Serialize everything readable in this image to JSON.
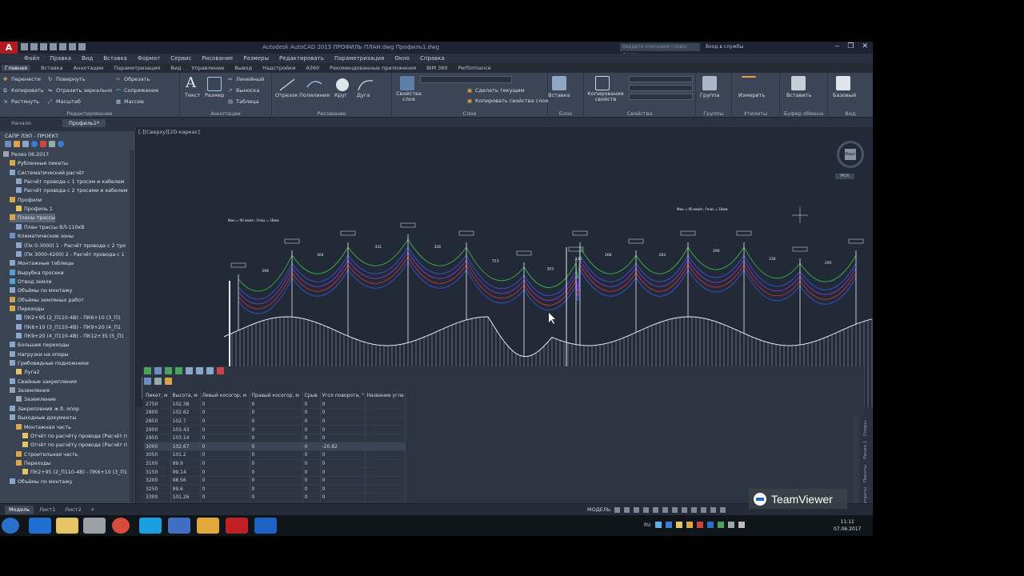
{
  "titlebar": {
    "logo": "A",
    "title": "Autodesk AutoCAD 2015   ПРОФИЛЬ ПЛАН.dwg   Профиль1.dwg",
    "search_placeholder": "Введите ключевое слово/фразу",
    "signin": "Вход в службы"
  },
  "menu": [
    "Файл",
    "Правка",
    "Вид",
    "Вставка",
    "Формат",
    "Сервис",
    "Рисование",
    "Размеры",
    "Редактировать",
    "Параметризация",
    "Окно",
    "Справка"
  ],
  "ribbon_tabs": [
    "Главная",
    "Вставка",
    "Аннотации",
    "Параметризация",
    "Вид",
    "Управление",
    "Вывод",
    "Надстройки",
    "A360",
    "Рекомендованные приложения",
    "BIM 360",
    "Performance"
  ],
  "ribbon": {
    "edit": {
      "title": "Редактирование",
      "buttons": [
        "Перенести",
        "Повернуть",
        "Обрезать",
        "Копировать",
        "Отразить зеркально",
        "Сопряжение",
        "Растянуть",
        "Масштаб",
        "Массив"
      ]
    },
    "annot": {
      "title": "Аннотации",
      "buttons": [
        "Текст",
        "Размер",
        "Линейный",
        "Выноска",
        "Таблица"
      ]
    },
    "draw": {
      "title": "Рисование",
      "buttons": [
        "Отрезок",
        "Полилиния",
        "Круг",
        "Дуга"
      ]
    },
    "layers": {
      "title": "Слои",
      "buttons": [
        "Свойства слоя",
        "Сделать текущим",
        "Копировать свойства слоя"
      ]
    },
    "block": {
      "title": "Блок",
      "button": "Вставка"
    },
    "props": {
      "title": "Свойства",
      "button": "Копирование свойств"
    },
    "groups": {
      "title": "Группы",
      "button": "Группа"
    },
    "util": {
      "title": "Утилиты",
      "button": "Измерить"
    },
    "clip": {
      "title": "Буфер обмена",
      "button": "Вставить"
    },
    "view": {
      "title": "Вид",
      "button": "Базовый"
    }
  },
  "doctabs": [
    "Начало",
    "Профиль1*"
  ],
  "leftpanel": {
    "title": "САПР ЛЭП - ПРОЕКТ",
    "tree": [
      "Релиз 06.2017",
      "Рубленные пикеты",
      "Систематический расчёт",
      "Расчёт провода с 1 тросом и кабелем",
      "Расчёт провода с 2 тросами и кабелем",
      "Профили",
      "Профиль 1",
      "Планы трассы",
      "План трассы ВЛ-110кВ",
      "Климатические зоны",
      "(Пк 0-3000) 1 - Расчёт провода с 2 тро",
      "(Пк 3000-4200) 2 - Расчёт провода с 1",
      "Монтажные таблицы",
      "Вырубка просеки",
      "Отвод земли",
      "Объёмы по монтажу",
      "Объёмы земляных работ",
      "Переходы",
      "ПК2+95 (2_П110-4В) - ПК6+10 (3_П1",
      "ПК6+10 (3_П110-4В) - ПК9+20 (4_П1",
      "ПК9+20 (4_П110-4В) - ПК12+35 (5_П1",
      "Большие переходы",
      "Нагрузки на опоры",
      "Грибовидные подножники",
      "Луга2",
      "Свайные закрепления",
      "Заземления",
      "Заземление",
      "Закрепления ж.б. опор",
      "Выходные документы",
      "Монтажная часть",
      "Отчёт по расчёту провода (Расчёт п",
      "Отчёт по расчёту провода (Расчёт п",
      "Строительная часть",
      "Переходы",
      "ПК2+95 (2_П110-4В) - ПК6+10 (3_П1",
      "Объёмы по монтажу"
    ]
  },
  "viewport": {
    "label": "[-][Сверху][2D-каркас]",
    "nav_label": "Верх",
    "nav_unit": "МСК",
    "axis_y": "Y",
    "axis_x": "X",
    "top_note": "Мин = 90 мм/м², Fmax = 18мм",
    "span_lengths": [
      "266",
      "304",
      "331",
      "326",
      "313",
      "303",
      "336",
      "266",
      "283",
      "290",
      "336",
      "295",
      "270",
      "275"
    ]
  },
  "table": {
    "columns": [
      "Пикет, м",
      "Высота, м",
      "Левый косогор, м",
      "Правый косогор, м",
      "Срыв",
      "Угол поворота, °",
      "Название угла"
    ],
    "rows": [
      [
        "2750",
        "102.38",
        "0",
        "0",
        "0",
        "0",
        ""
      ],
      [
        "2800",
        "102.62",
        "0",
        "0",
        "0",
        "0",
        ""
      ],
      [
        "2850",
        "102.7",
        "0",
        "0",
        "0",
        "0",
        ""
      ],
      [
        "2900",
        "103.43",
        "0",
        "0",
        "0",
        "0",
        ""
      ],
      [
        "2950",
        "103.14",
        "0",
        "0",
        "0",
        "0",
        ""
      ],
      [
        "3000",
        "102.67",
        "0",
        "0",
        "0",
        "-20.82",
        ""
      ],
      [
        "3050",
        "101.2",
        "0",
        "0",
        "0",
        "0",
        ""
      ],
      [
        "3100",
        "99.9",
        "0",
        "0",
        "0",
        "0",
        ""
      ],
      [
        "3150",
        "99.14",
        "0",
        "0",
        "0",
        "0",
        ""
      ],
      [
        "3200",
        "98.56",
        "0",
        "0",
        "0",
        "0",
        ""
      ],
      [
        "3250",
        "99.6",
        "0",
        "0",
        "0",
        "0",
        ""
      ],
      [
        "3300",
        "101.26",
        "0",
        "0",
        "0",
        "0",
        ""
      ]
    ],
    "side_tabs": [
      "Опоры",
      "Линия 1",
      "Пикеты",
      "Затраты"
    ]
  },
  "status": {
    "tabs": [
      "Модель",
      "Лист1",
      "Лист2"
    ],
    "mode": "МОДЕЛЬ"
  },
  "teamviewer": "TeamViewer",
  "tray": {
    "lang": "RU",
    "time": "11:11",
    "date": "07.06.2017"
  },
  "colors": {
    "wire_green": "#3fbf4a",
    "wire_blue": "#3b55e6",
    "wire_red": "#d2353c",
    "wire_purple": "#8a3bd6",
    "ground": "#e8eaee",
    "accent_red": "#b3191f"
  }
}
